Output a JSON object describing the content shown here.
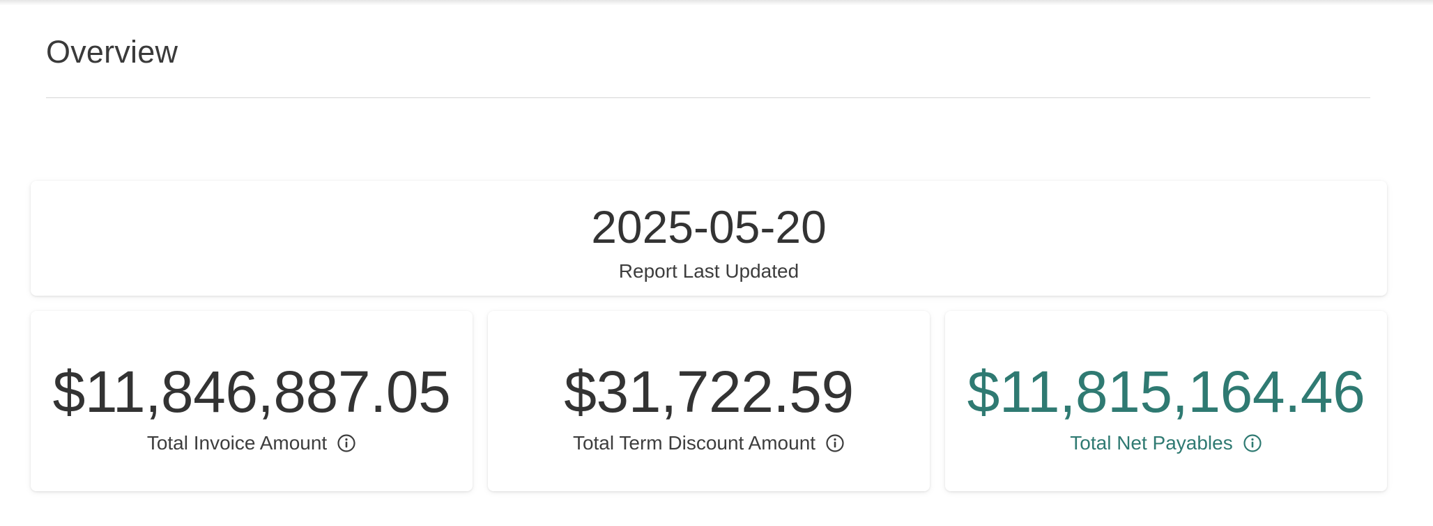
{
  "page": {
    "title": "Overview"
  },
  "report": {
    "last_updated_value": "2025-05-20",
    "last_updated_label": "Report Last Updated"
  },
  "metrics": [
    {
      "value": "$11,846,887.05",
      "label": "Total Invoice Amount",
      "icon": "info-icon"
    },
    {
      "value": "$31,722.59",
      "label": "Total Term Discount Amount",
      "icon": "info-icon"
    },
    {
      "value": "$11,815,164.46",
      "label": "Total Net Payables",
      "icon": "info-icon",
      "color": "#2f7a72"
    }
  ],
  "colors": {
    "text": "#333333",
    "accent": "#2f7a72",
    "divider": "#d6d6d6"
  }
}
